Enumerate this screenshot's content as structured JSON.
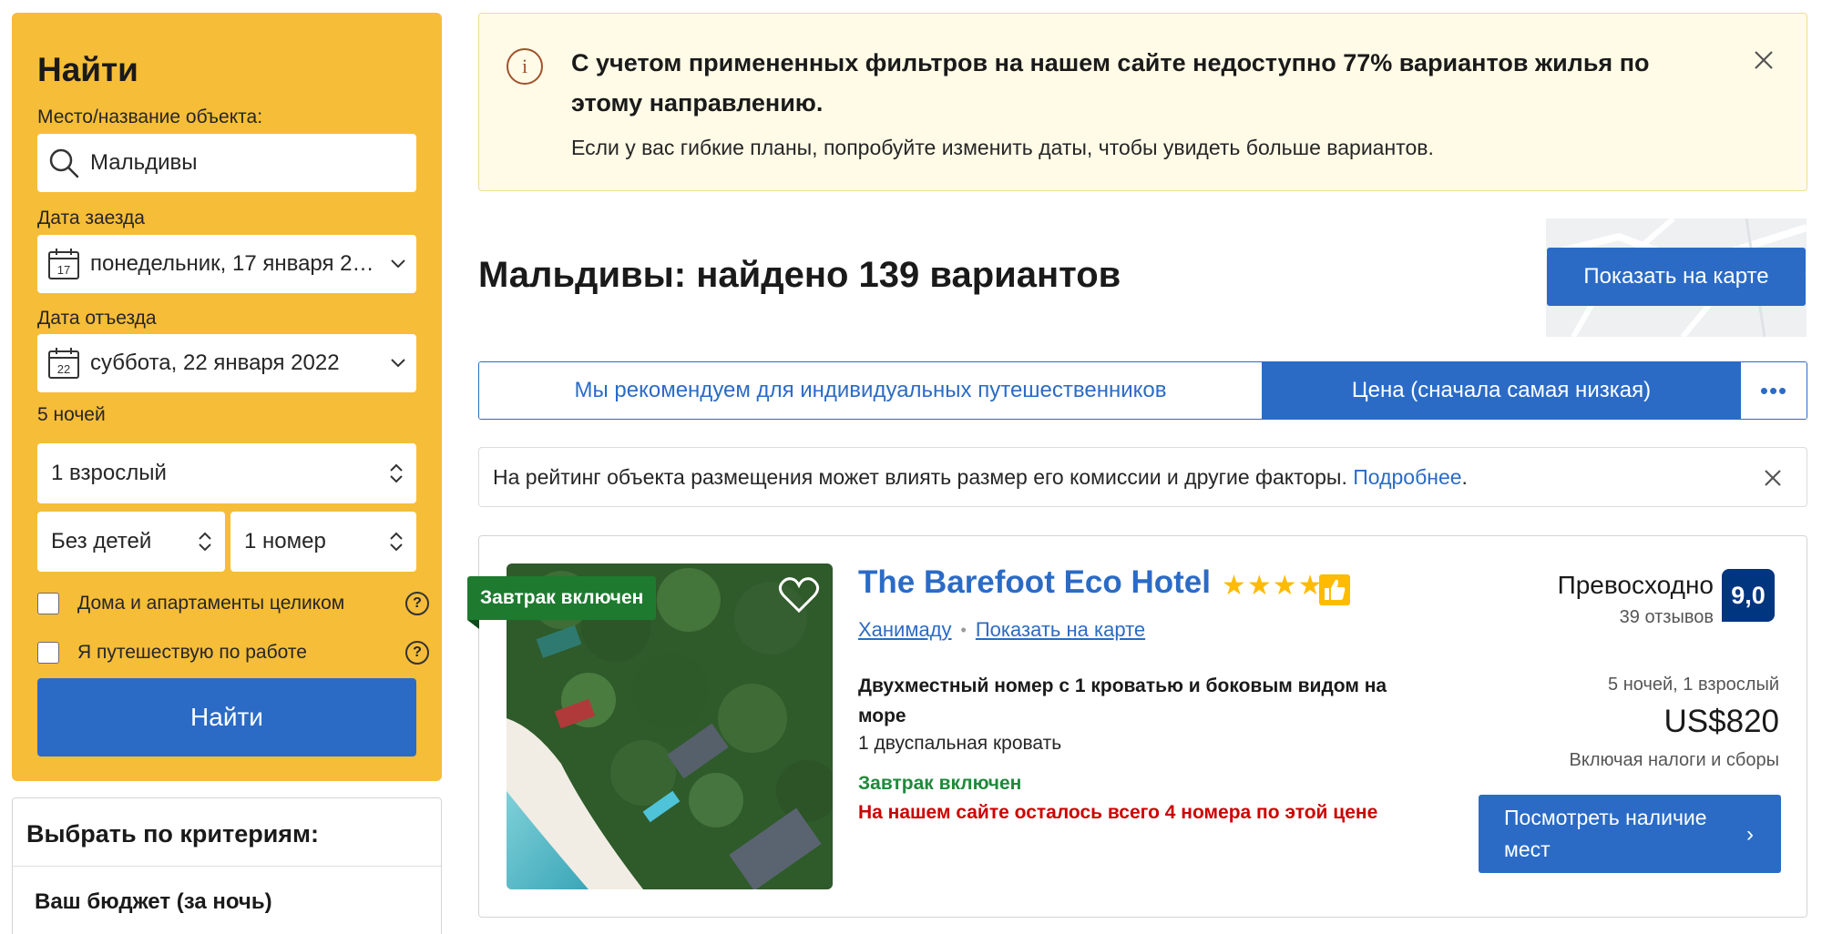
{
  "search": {
    "title": "Найти",
    "destination_label": "Место/название объекта:",
    "destination_value": "Мальдивы",
    "checkin_label": "Дата заезда",
    "checkin_day": "17",
    "checkin_value": "понедельник, 17 января 2…",
    "checkout_label": "Дата отъезда",
    "checkout_day": "22",
    "checkout_value": "суббота, 22 января 2022",
    "nights": "5 ночей",
    "adults": "1 взрослый",
    "children": "Без детей",
    "rooms": "1 номер",
    "option_entire_homes": "Дома и апартаменты целиком",
    "option_business_trip": "Я путешествую по работе",
    "help_symbol": "?",
    "submit_label": "Найти"
  },
  "filters": {
    "title": "Выбрать по критериям:",
    "budget_label": "Ваш бюджет (за ночь)"
  },
  "alert": {
    "icon_symbol": "i",
    "title": "С учетом примененных фильтров на нашем сайте недоступно 77% вариантов жилья по этому направлению.",
    "text": "Если у вас гибкие планы, попробуйте изменить даты, чтобы увидеть больше вариантов."
  },
  "results": {
    "heading": "Мальдивы: найдено 139 вариантов",
    "map_button": "Показать на карте"
  },
  "sort": {
    "tabs": [
      "Мы рекомендуем для индивидуальных путешественников",
      "Цена (сначала самая низкая)",
      "•••"
    ]
  },
  "notice": {
    "text": "На рейтинг объекта размещения может влиять размер его комиссии и другие факторы. ",
    "link": "Подробнее",
    "end": "."
  },
  "hotel": {
    "badge": "Завтрак включен",
    "name": "The Barefoot Eco Hotel",
    "stars": "★★★★",
    "district": "Ханимаду",
    "map_link": "Показать на карте",
    "room_name": "Двухместный номер с 1 кроватью и боковым видом на море",
    "bed": "1 двуспальная кровать",
    "breakfast": "Завтрак включен",
    "scarcity": "На нашем сайте осталось всего 4 номера по этой цене",
    "rating_word": "Превосходно",
    "reviews": "39 отзывов",
    "score": "9,0",
    "stay": "5 ночей, 1 взрослый",
    "price": "US$820",
    "price_note": "Включая налоги и сборы",
    "cta": "Посмотреть наличие мест",
    "cta_arrow": "›"
  },
  "colors": {
    "search_panel": "#f6bd38",
    "primary_blue": "#2b6bc6",
    "dark_blue": "#003580",
    "star_yellow": "#febb02",
    "breakfast_green": "#1e7a2f",
    "scarcity_red": "#cc0000"
  }
}
